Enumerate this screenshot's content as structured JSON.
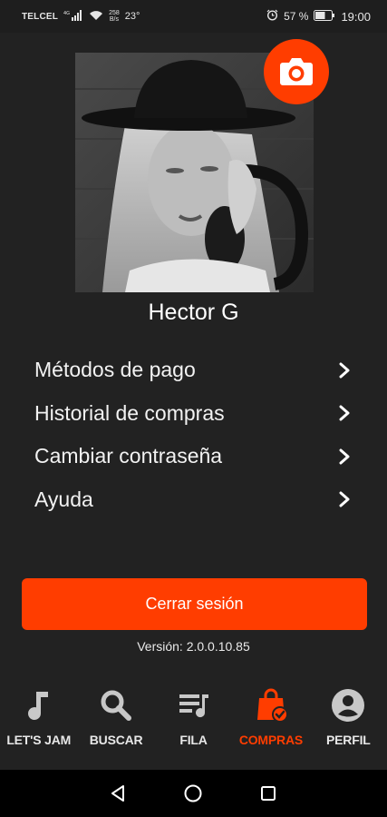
{
  "status_bar": {
    "carrier": "TELCEL",
    "network_tiny": "4G",
    "data_rate_top": "258",
    "data_rate_bottom": "B/s",
    "temperature": "23°",
    "battery_percent": "57 %",
    "time": "19:00"
  },
  "profile": {
    "name": "Hector G",
    "camera_icon": "camera-icon"
  },
  "menu": {
    "items": [
      {
        "label": "Métodos de pago",
        "icon": "chevron-right-icon"
      },
      {
        "label": "Historial de compras",
        "icon": "chevron-right-icon"
      },
      {
        "label": "Cambiar contraseña",
        "icon": "chevron-right-icon"
      },
      {
        "label": "Ayuda",
        "icon": "chevron-right-icon"
      }
    ]
  },
  "logout_label": "Cerrar sesión",
  "version_text": "Versión: 2.0.0.10.85",
  "bottom_nav": {
    "items": [
      {
        "label": "LET'S JAM",
        "icon": "music-note-icon",
        "active": false
      },
      {
        "label": "BUSCAR",
        "icon": "search-icon",
        "active": false
      },
      {
        "label": "FILA",
        "icon": "queue-icon",
        "active": false
      },
      {
        "label": "COMPRAS",
        "icon": "shopping-bag-icon",
        "active": true
      },
      {
        "label": "PERFIL",
        "icon": "user-icon",
        "active": false
      }
    ]
  },
  "colors": {
    "accent": "#ff3d00",
    "background": "#222222",
    "text": "#ffffff",
    "inactive_icon": "#c8c8c8"
  }
}
